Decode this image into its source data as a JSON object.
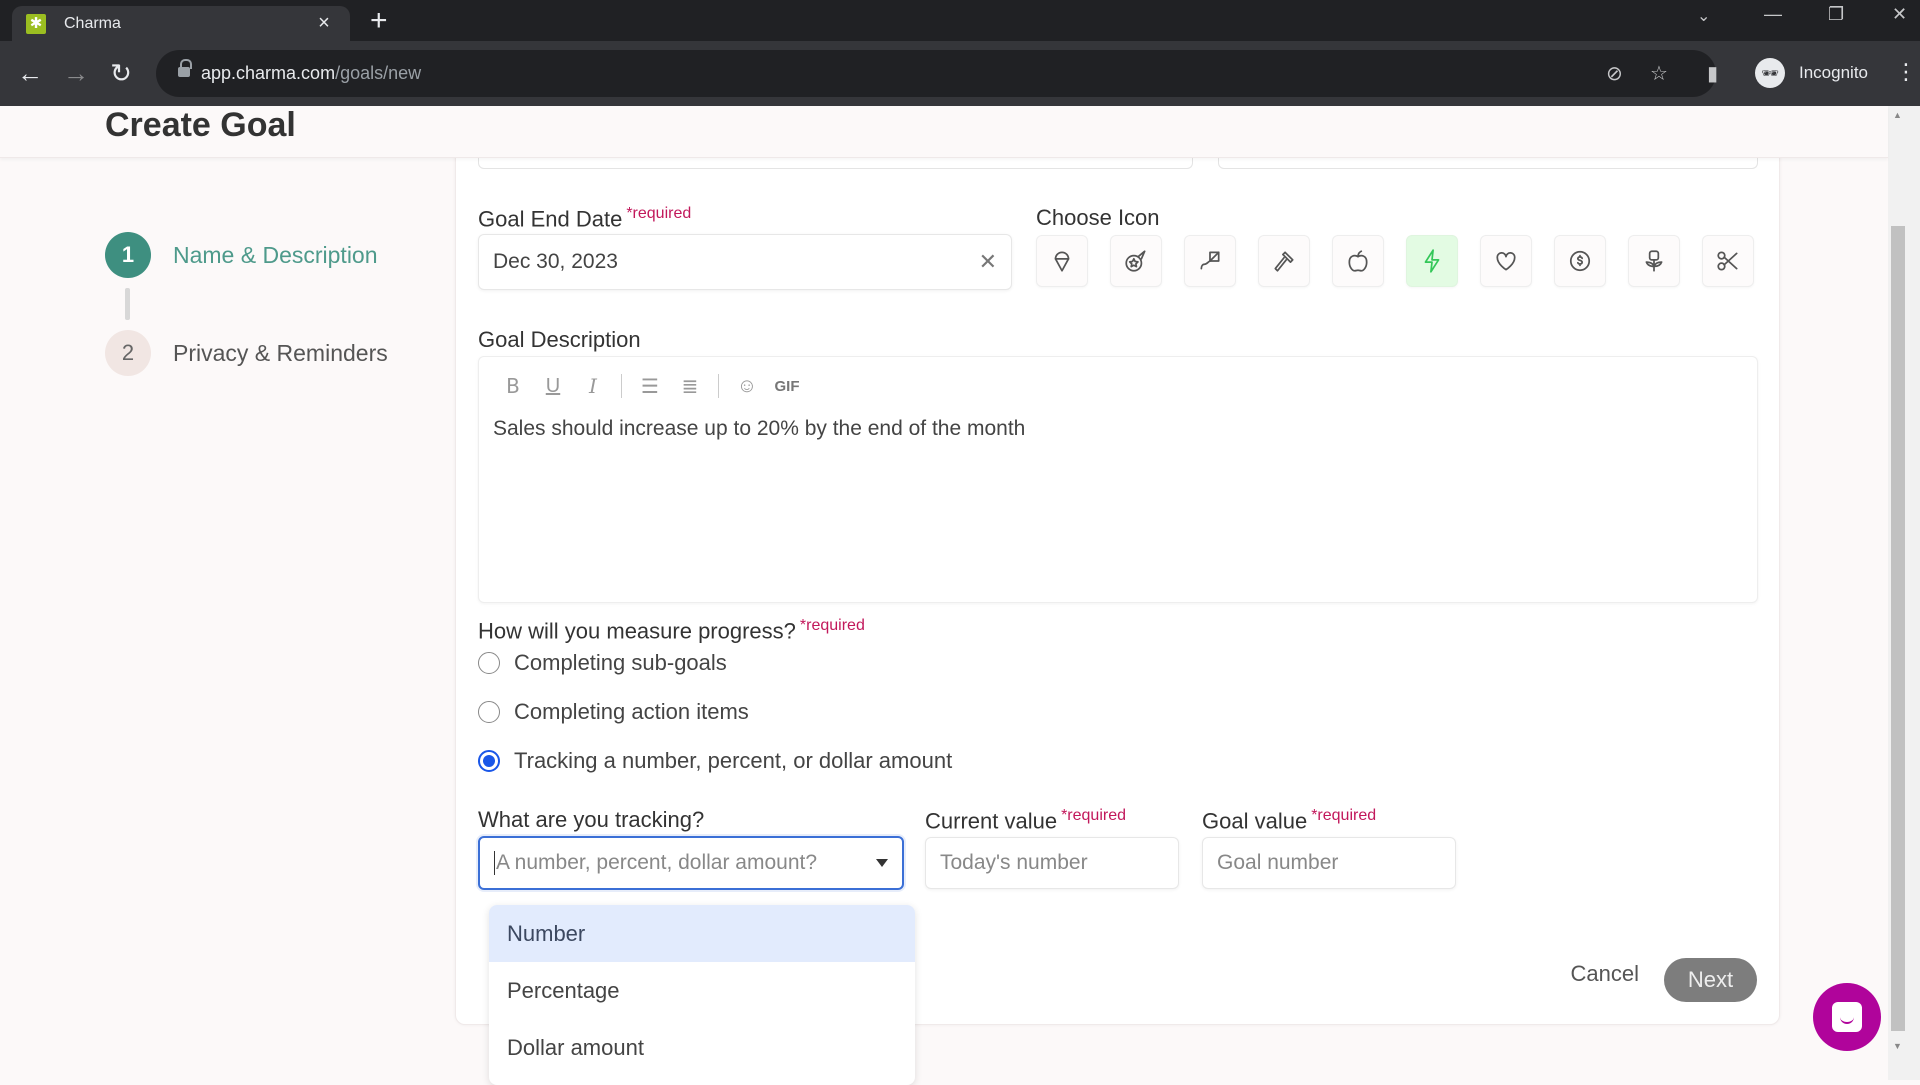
{
  "browser": {
    "tab_title": "Charma",
    "url_host": "app.charma.com",
    "url_path": "/goals/new",
    "profile_label": "Incognito"
  },
  "page": {
    "title": "Create Goal"
  },
  "stepper": {
    "steps": [
      {
        "number": "1",
        "label": "Name & Description",
        "state": "active"
      },
      {
        "number": "2",
        "label": "Privacy & Reminders",
        "state": "inactive"
      }
    ]
  },
  "form": {
    "end_date": {
      "label": "Goal End Date",
      "required": "*required",
      "value": "Dec 30, 2023"
    },
    "choose_icon": {
      "label": "Choose Icon",
      "icons": [
        "ice-cream",
        "rocket-star",
        "kite",
        "hammer",
        "apple",
        "lightning",
        "heart",
        "dollar-badge",
        "flower",
        "scissors"
      ],
      "selected": "lightning"
    },
    "description": {
      "label": "Goal Description",
      "toolbar": [
        "B",
        "U",
        "I",
        "bullet-list",
        "numbered-list",
        "emoji",
        "GIF"
      ],
      "gif_label": "GIF",
      "text": "Sales should increase up to 20% by the end of the month"
    },
    "measure": {
      "label": "How will you measure progress?",
      "required": "*required",
      "options": [
        {
          "label": "Completing sub-goals",
          "checked": false
        },
        {
          "label": "Completing action items",
          "checked": false
        },
        {
          "label": "Tracking a number, percent, or dollar amount",
          "checked": true
        }
      ]
    },
    "tracking": {
      "label": "What are you tracking?",
      "placeholder": "A number, percent, dollar amount?",
      "options": [
        "Number",
        "Percentage",
        "Dollar amount"
      ],
      "highlighted": "Number"
    },
    "current_value": {
      "label": "Current value",
      "required": "*required",
      "placeholder": "Today's number"
    },
    "goal_value": {
      "label": "Goal value",
      "required": "*required",
      "placeholder": "Goal number"
    },
    "actions": {
      "cancel": "Cancel",
      "next": "Next"
    }
  },
  "colors": {
    "accent_step": "#3e8f80",
    "required": "#c2185b",
    "radio_checked": "#1a57e8",
    "selected_icon": "#34c759",
    "chat_fab": "#b0049b"
  }
}
